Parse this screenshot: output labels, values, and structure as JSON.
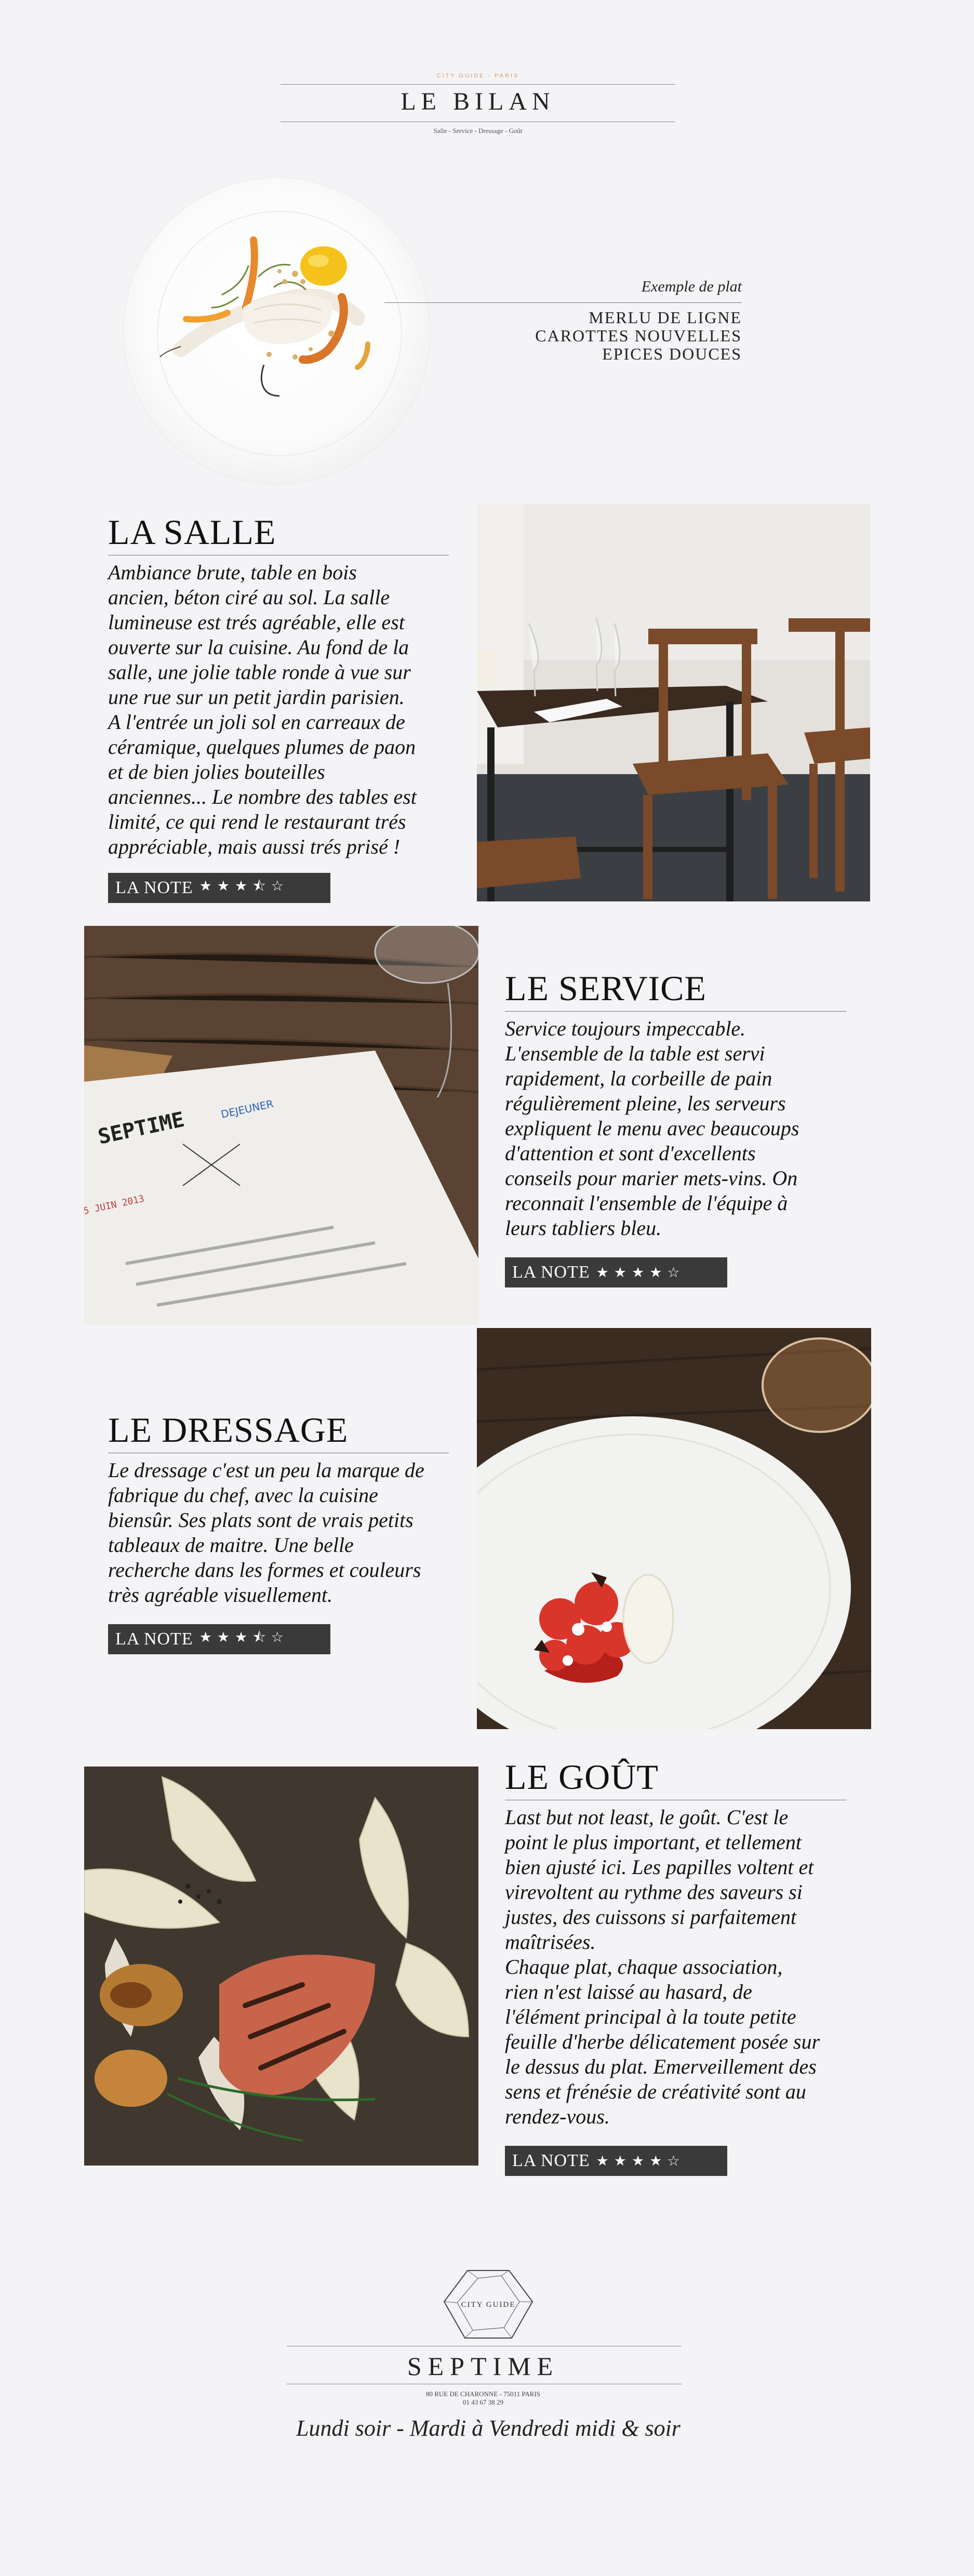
{
  "header": {
    "kicker": "CITY GUIDE - PARIS",
    "brand": "LE BILAN",
    "tagline": "Salle - Service - Dressage - Goût"
  },
  "featured": {
    "kicker": "Exemple de plat",
    "dish_lines": [
      "MERLU DE LIGNE",
      "CAROTTES NOUVELLES",
      "EPICES DOUCES"
    ]
  },
  "sections": {
    "salle": {
      "title": "LA SALLE",
      "text": "Ambiance brute, table en bois\nancien, béton ciré au sol. La salle\nlumineuse est trés agréable, elle est\nouverte sur la cuisine. Au fond de la\nsalle, une jolie table ronde à vue sur\nune rue sur un petit jardin parisien.\nA l'entrée un joli sol en carreaux de\ncéramique, quelques plumes de paon\net de bien jolies bouteilles\nanciennes... Le nombre des tables est\nlimité, ce qui rend le restaurant trés\nappréciable, mais aussi trés prisé !",
      "note_label": "LA NOTE",
      "rating": 3.5,
      "stars": "★★★⯪☆"
    },
    "service": {
      "title": "LE SERVICE",
      "text": "Service toujours impeccable.\nL'ensemble de la table est servi\nrapidement, la corbeille de pain\nrégulièrement pleine, les serveurs\nexpliquent le menu avec beaucoups\nd'attention et sont d'excellents\nconseils pour marier mets-vins. On\nreconnait l'ensemble de l'équipe à\nleurs tabliers bleu.",
      "note_label": "LA NOTE",
      "rating": 4,
      "stars": "★★★★☆"
    },
    "dressage": {
      "title": "LE DRESSAGE",
      "text": "Le dressage c'est un peu la marque de\nfabrique du chef, avec la cuisine\nbiensûr. Ses plats sont de vrais petits\ntableaux de maitre. Une belle\nrecherche dans les formes et couleurs\ntrès agréable visuellement.",
      "note_label": "LA NOTE",
      "rating": 3.5,
      "stars": "★★★⯪☆"
    },
    "gout": {
      "title": "LE GOÛT",
      "text": "Last but not least, le goût. C'est le\npoint le plus important, et tellement\nbien ajusté ici. Les papilles voltent et\nvirevoltent au rythme des saveurs si\njustes, des cuissons si parfaitement\nmaîtrisées.\nChaque plat, chaque association,\nrien n'est laissé au hasard, de\nl'élément principal à la toute petite\nfeuille d'herbe délicatement posée sur\nle dessus du plat. Emerveillement des\nsens et frénésie de créativité sont au\nrendez-vous.",
      "note_label": "LA NOTE",
      "rating": 4,
      "stars": "★★★★☆"
    }
  },
  "menu_card": {
    "brand": "SEPTIME",
    "label": "DEJEUNER",
    "date": "5 JUIN 2013"
  },
  "footer": {
    "logo_text": "CITY GUIDE",
    "name": "SEPTIME",
    "address": "80 RUE DE CHARONNE - 75011 PARIS",
    "phone": "01 43 67 38 29",
    "hours": "Lundi soir - Mardi à Vendredi midi & soir"
  },
  "colors": {
    "background": "#f4f3f6",
    "note_bar": "#3a3a3a",
    "kicker_accent": "#d89a6a"
  }
}
